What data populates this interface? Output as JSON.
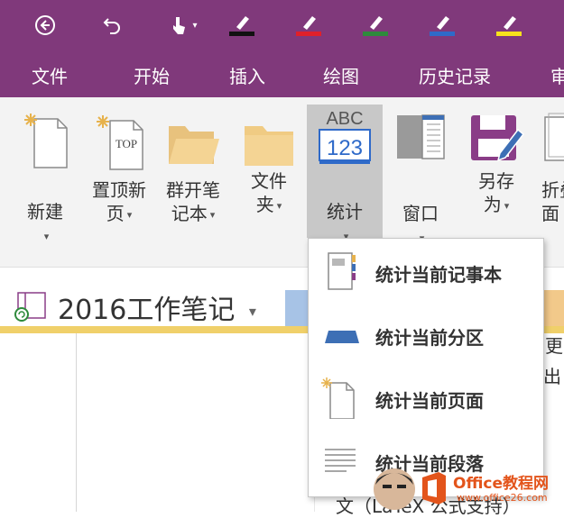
{
  "quick_access": {
    "back_icon": "back-circle-icon",
    "undo_icon": "undo-icon",
    "touch_icon": "touch-mode-icon",
    "pen_colors": [
      "#111111",
      "#e0202a",
      "#2e8a3c",
      "#2f6ac9",
      "#f7e21c"
    ]
  },
  "tabs": [
    "文件",
    "开始",
    "插入",
    "绘图",
    "历史记录",
    "审"
  ],
  "ribbon": {
    "new": "新建",
    "pin_top": "置顶新\n页",
    "open_group": "群开笔\n记本",
    "folder": "文件\n夹",
    "stats": "统计",
    "stats_icon_top": "ABC",
    "stats_icon_num": "123",
    "window": "窗口",
    "save_as": "另存\n为",
    "fold": "折叠\n面",
    "top_badge": "TOP"
  },
  "notebook": {
    "title": "2016工作笔记"
  },
  "menu": {
    "items": [
      "统计当前记事本",
      "统计当前分区",
      "统计当前页面",
      "统计当前段落"
    ]
  },
  "page_text": {
    "right_snippet_1": "更",
    "right_snippet_2": "出",
    "right_snippet_3": "",
    "bottom_text": "文（LaTeX 公式支持）"
  },
  "watermark": {
    "brand": "Office教程网",
    "url": "www.office26.com"
  }
}
